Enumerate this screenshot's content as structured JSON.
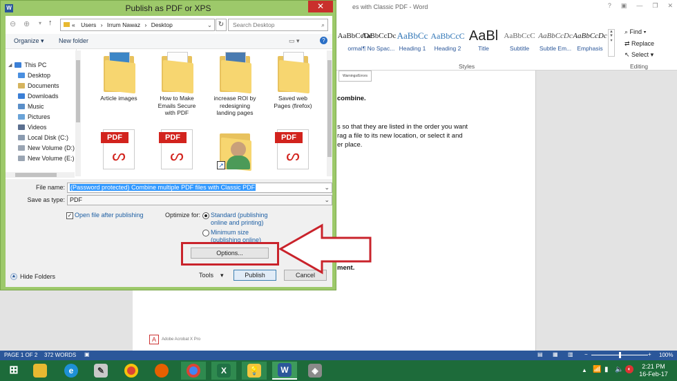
{
  "word": {
    "title": "es with Classic PDF - Word",
    "styles": [
      {
        "preview": "AaBbCcDc",
        "name": "ormal"
      },
      {
        "preview": "AaBbCcDc",
        "name": "¶ No Spac..."
      },
      {
        "preview": "AaBbCc",
        "name": "Heading 1"
      },
      {
        "preview": "AaBbCcC",
        "name": "Heading 2"
      },
      {
        "preview": "AaBl",
        "name": "Title"
      },
      {
        "preview": "AaBbCcC",
        "name": "Subtitle"
      },
      {
        "preview": "AaBbCcDc",
        "name": "Subtle Em..."
      },
      {
        "preview": "AaBbCcDc",
        "name": "Emphasis"
      }
    ],
    "styles_group": "Styles",
    "editing": {
      "find": "Find",
      "replace": "Replace",
      "select": "Select",
      "group": "Editing"
    },
    "doc_lines": {
      "small_label": "Warnings/Errors",
      "heading": "combine.",
      "para1": "s so that they are listed in the order you want",
      "para2": "rag a file to its new location, or select it and",
      "para3": "er place.",
      "heading2": "ment.",
      "footer_logo": "Adobe Acrobat X Pro"
    },
    "status": {
      "page": "PAGE 1 OF 2",
      "words": "372 WORDS",
      "zoom": "100%"
    },
    "clock": {
      "time": "2:21 PM",
      "date": "16-Feb-17"
    }
  },
  "dialog": {
    "title": "Publish as PDF or XPS",
    "close": "✕",
    "address": {
      "prefix": "«",
      "parts": [
        "Users",
        "Irrum Nawaz",
        "Desktop"
      ]
    },
    "search_placeholder": "Search Desktop",
    "toolbar": {
      "organize": "Organize",
      "new_folder": "New folder"
    },
    "nav": [
      "This PC",
      "Desktop",
      "Documents",
      "Downloads",
      "Music",
      "Pictures",
      "Videos",
      "Local Disk (C:)",
      "New Volume (D:)",
      "New Volume (E:)"
    ],
    "files": [
      {
        "name": "Article images",
        "kind": "folder"
      },
      {
        "name": "How to Make Emails Secure with PDF",
        "kind": "folder"
      },
      {
        "name": "increase ROI by redesigning landing pages",
        "kind": "folder"
      },
      {
        "name": "Saved web Pages (firefox)",
        "kind": "folder"
      },
      {
        "name": "",
        "kind": "pdf"
      },
      {
        "name": "",
        "kind": "pdf"
      },
      {
        "name": "",
        "kind": "shortcut"
      },
      {
        "name": "",
        "kind": "pdf"
      }
    ],
    "file_name_label": "File name:",
    "file_name_value": "(Password protected) Combine multiple PDF files with Classic PDF",
    "save_type_label": "Save as type:",
    "save_type_value": "PDF",
    "open_after": "Open file after publishing",
    "optimize_label": "Optimize for:",
    "opt_standard": "Standard (publishing online and printing)",
    "opt_minimum": "Minimum size (publishing online)",
    "options_btn": "Options...",
    "hide_folders": "Hide Folders",
    "tools": "Tools",
    "publish": "Publish",
    "cancel": "Cancel"
  }
}
